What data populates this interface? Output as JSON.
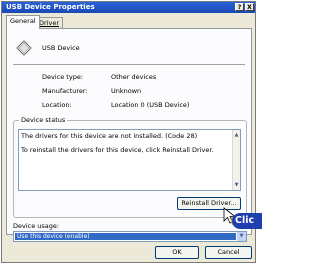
{
  "window": {
    "title": "USB Device Properties",
    "help_button": "?",
    "close_button": "X"
  },
  "tabs": [
    {
      "label": "General",
      "active": true
    },
    {
      "label": "Driver",
      "active": false
    }
  ],
  "device": {
    "name": "USB Device",
    "icon": "usb-device-icon",
    "properties": [
      {
        "label": "Device type:",
        "value": "Other devices"
      },
      {
        "label": "Manufacturer:",
        "value": "Unknown"
      },
      {
        "label": "Location:",
        "value": "Location 0 (USB Device)"
      }
    ]
  },
  "status": {
    "group_label": "Device status",
    "lines": [
      "The drivers for this device are not installed. (Code 28)",
      "To reinstall the drivers for this device, click Reinstall Driver."
    ]
  },
  "buttons": {
    "reinstall": "Reinstall Driver...",
    "ok": "OK",
    "cancel": "Cancel"
  },
  "usage": {
    "label": "Device usage:",
    "selected": "Use this device (enable)"
  },
  "annotation": {
    "callout_text": "Clic"
  },
  "colors": {
    "titlebar": "#1a48b5",
    "selection": "#316ac5",
    "callout": "#1f3fae"
  }
}
